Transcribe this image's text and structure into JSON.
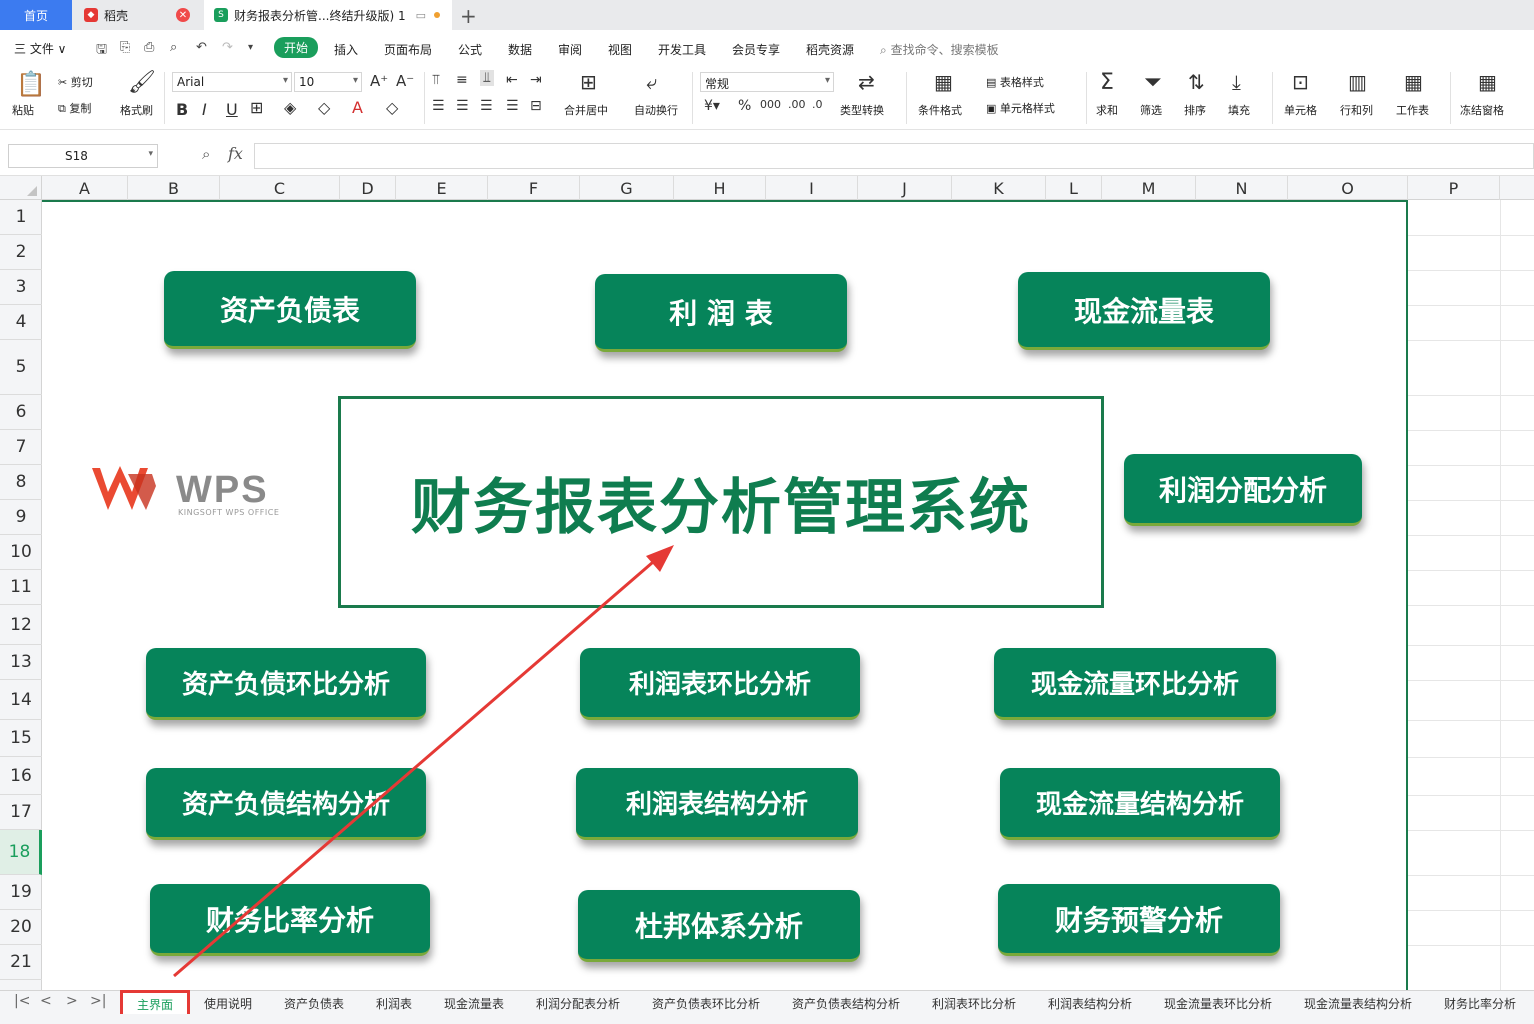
{
  "tabs": {
    "home": "首页",
    "daoke": "稻壳",
    "doc": "财务报表分析管...终结升级版) 1"
  },
  "menu": {
    "file": "三 文件 ∨",
    "items": [
      "开始",
      "插入",
      "页面布局",
      "公式",
      "数据",
      "审阅",
      "视图",
      "开发工具",
      "会员专享",
      "稻壳资源"
    ],
    "search": "查找命令、搜索模板"
  },
  "ribbon": {
    "paste": "粘贴",
    "cut": "剪切",
    "copy": "复制",
    "format_painter": "格式刷",
    "font": "Arial",
    "size": "10",
    "merge": "合并居中",
    "wrap": "自动换行",
    "number_format": "常规",
    "convert": "类型转换",
    "cond_format": "条件格式",
    "table_style": "表格样式",
    "cell_style": "单元格样式",
    "sum": "求和",
    "filter": "筛选",
    "sort": "排序",
    "fill": "填充",
    "cell": "单元格",
    "rowcol": "行和列",
    "worksheet": "工作表",
    "freeze": "冻结窗格"
  },
  "formula": {
    "cell_ref": "S18",
    "fx": "fx"
  },
  "columns": [
    "A",
    "B",
    "C",
    "D",
    "E",
    "F",
    "G",
    "H",
    "I",
    "J",
    "K",
    "L",
    "M",
    "N",
    "O",
    "P"
  ],
  "rows": [
    "1",
    "2",
    "3",
    "4",
    "5",
    "6",
    "7",
    "8",
    "9",
    "10",
    "11",
    "12",
    "13",
    "14",
    "15",
    "16",
    "17",
    "18",
    "19",
    "20",
    "21"
  ],
  "selected_row": "18",
  "dashboard": {
    "title": "财务报表分析管理系统",
    "logo_text": "KINGSOFT WPS OFFICE",
    "buttons": {
      "balance": "资产负债表",
      "profit": "利 润 表",
      "cashflow": "现金流量表",
      "profit_dist": "利润分配分析",
      "balance_mom": "资产负债环比分析",
      "profit_mom": "利润表环比分析",
      "cash_mom": "现金流量环比分析",
      "balance_struct": "资产负债结构分析",
      "profit_struct": "利润表结构分析",
      "cash_struct": "现金流量结构分析",
      "ratio": "财务比率分析",
      "dupont": "杜邦体系分析",
      "warning": "财务预警分析"
    }
  },
  "sheet_tabs": [
    "主界面",
    "使用说明",
    "资产负债表",
    "利润表",
    "现金流量表",
    "利润分配表分析",
    "资产负债表环比分析",
    "资产负债表结构分析",
    "利润表环比分析",
    "利润表结构分析",
    "现金流量表环比分析",
    "现金流量表结构分析",
    "财务比率分析"
  ],
  "colors": {
    "accent": "#1a9e5c",
    "button": "#06845a",
    "title": "#0f7d4f",
    "highlight": "#e53935"
  }
}
